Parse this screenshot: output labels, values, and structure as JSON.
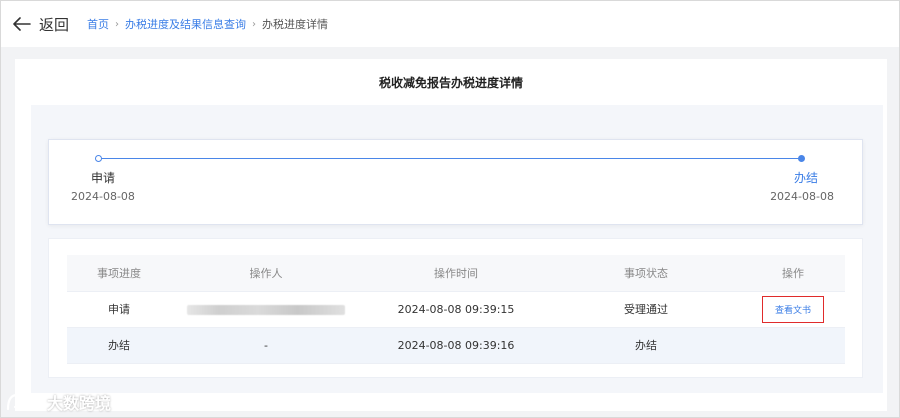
{
  "header": {
    "back_label": "返回",
    "breadcrumbs": [
      {
        "label": "首页"
      },
      {
        "label": "办税进度及结果信息查询"
      },
      {
        "label": "办税进度详情"
      }
    ]
  },
  "page": {
    "title": "税收减免报告办税进度详情"
  },
  "timeline": {
    "steps": [
      {
        "name": "申请",
        "date": "2024-08-08"
      },
      {
        "name": "办结",
        "date": "2024-08-08"
      }
    ],
    "accent_color": "#4a86e8"
  },
  "table": {
    "columns": [
      "事项进度",
      "操作人",
      "操作时间",
      "事项状态",
      "操作"
    ],
    "rows": [
      {
        "progress": "申请",
        "operator": "",
        "time": "2024-08-08 09:39:15",
        "status": "受理通过",
        "action": "查看文书"
      },
      {
        "progress": "办结",
        "operator": "-",
        "time": "2024-08-08 09:39:16",
        "status": "办结",
        "action": ""
      }
    ]
  },
  "watermark": {
    "text": "大数跨境"
  },
  "icons": {
    "back": "arrow-left-icon",
    "separator": "chevron-right-icon"
  }
}
